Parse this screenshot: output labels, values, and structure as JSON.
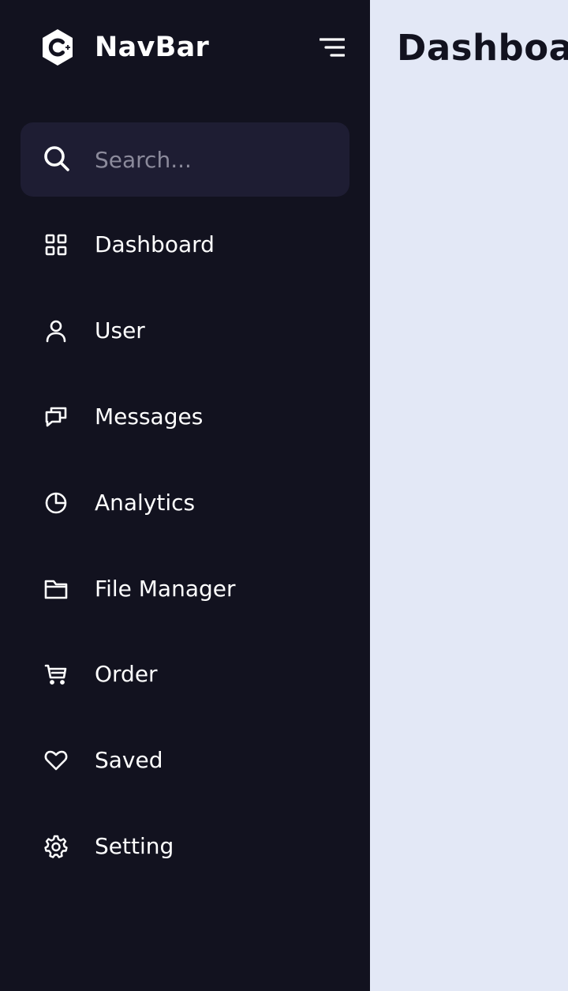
{
  "brand": {
    "name": "NavBar",
    "logo_icon": "code-hexagon-icon"
  },
  "search": {
    "placeholder": "Search...",
    "value": "",
    "icon": "search-icon"
  },
  "nav": {
    "items": [
      {
        "label": "Dashboard",
        "icon": "grid-icon"
      },
      {
        "label": "User",
        "icon": "user-icon"
      },
      {
        "label": "Messages",
        "icon": "chat-icon"
      },
      {
        "label": "Analytics",
        "icon": "pie-chart-icon"
      },
      {
        "label": "File Manager",
        "icon": "folder-icon"
      },
      {
        "label": "Order",
        "icon": "cart-icon"
      },
      {
        "label": "Saved",
        "icon": "heart-icon"
      },
      {
        "label": "Setting",
        "icon": "gear-icon"
      }
    ]
  },
  "main": {
    "title": "Dashboard"
  },
  "colors": {
    "sidebar_bg": "#12121f",
    "search_bg": "#1e1d33",
    "main_bg": "#e3e8f6",
    "text_light": "#ffffff",
    "text_dark": "#12121f",
    "placeholder": "#8b8a9b"
  }
}
